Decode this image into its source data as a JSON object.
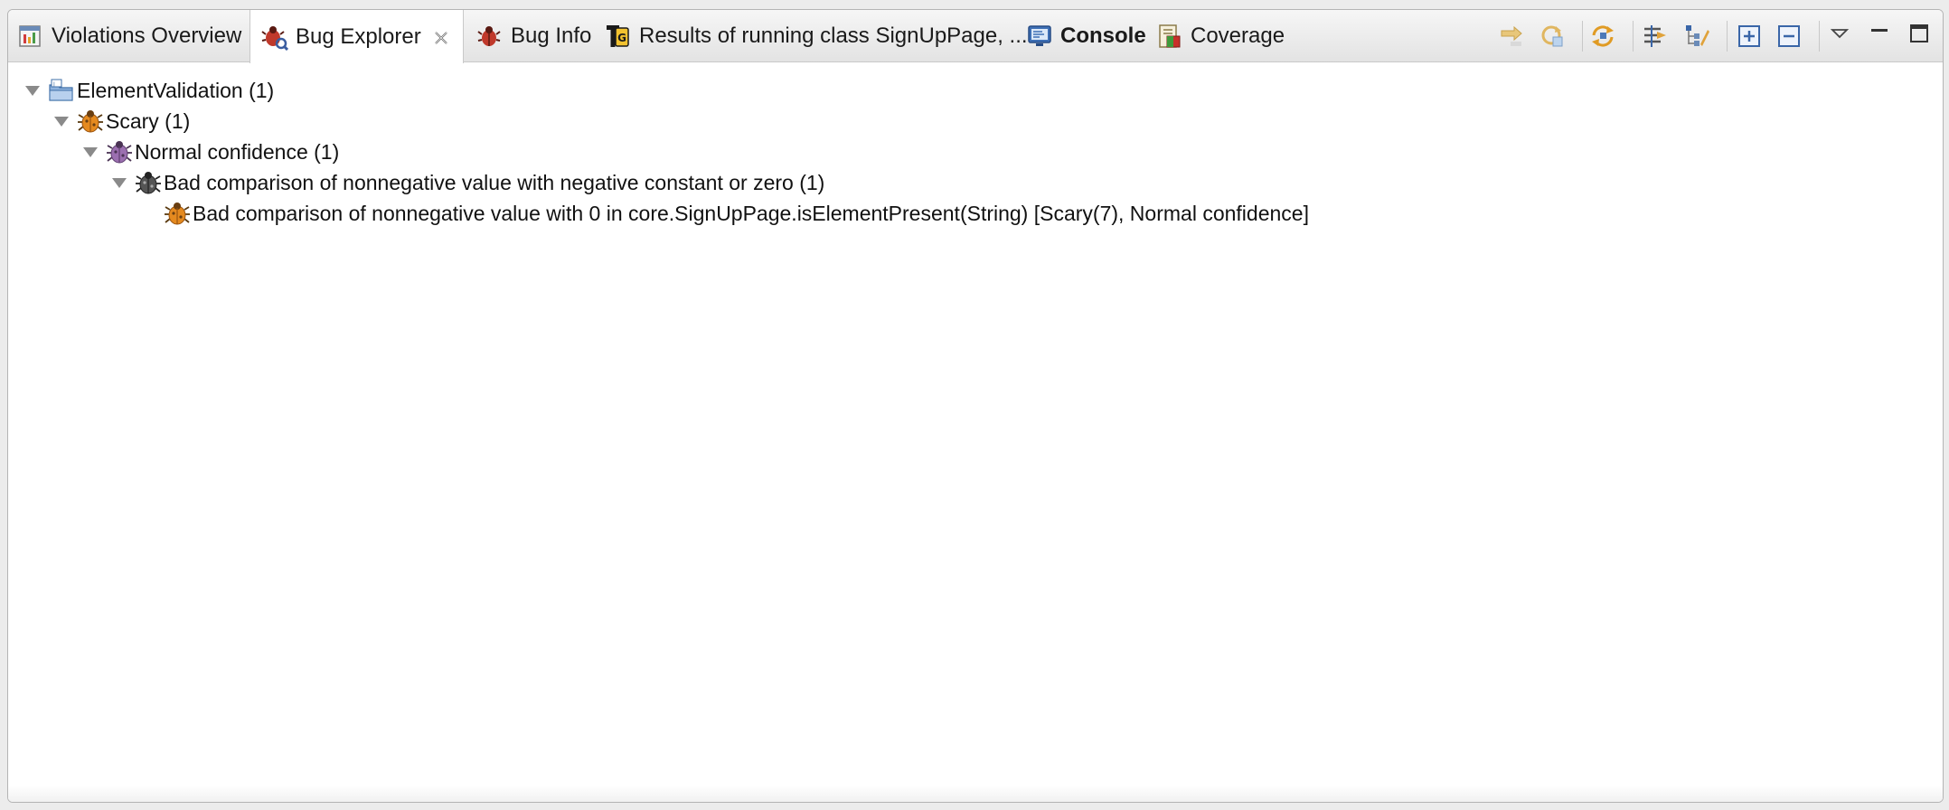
{
  "tabs": [
    {
      "label": "Violations Overview",
      "icon": "violations-overview-icon",
      "active": false,
      "bold": false
    },
    {
      "label": "Bug Explorer",
      "icon": "bug-explorer-icon",
      "active": true,
      "bold": false,
      "closable": true
    },
    {
      "label": "Bug Info",
      "icon": "bug-info-icon",
      "active": false,
      "bold": false
    },
    {
      "label": "Results of running class SignUpPage, ...",
      "icon": "testng-results-icon",
      "active": false,
      "bold": false
    },
    {
      "label": "Console",
      "icon": "console-icon",
      "active": false,
      "bold": true
    },
    {
      "label": "Coverage",
      "icon": "coverage-icon",
      "active": false,
      "bold": false
    }
  ],
  "toolbar": {
    "buttons": [
      "go-to-next-icon",
      "refresh-icon",
      "synchronize-icon",
      "filter-icon",
      "group-by-icon",
      "expand-all-icon",
      "collapse-all-icon",
      "view-menu-icon",
      "minimize-icon",
      "maximize-icon"
    ]
  },
  "tree": [
    {
      "label": "ElementValidation (1)",
      "icon": "project-folder-icon",
      "level": 0,
      "expanded": true
    },
    {
      "label": "Scary (1)",
      "icon": "scary-bug-icon",
      "level": 1,
      "expanded": true
    },
    {
      "label": "Normal confidence (1)",
      "icon": "normal-confidence-bug-icon",
      "level": 2,
      "expanded": true
    },
    {
      "label": "Bad comparison of nonnegative value with negative constant or zero (1)",
      "icon": "bug-pattern-icon",
      "level": 3,
      "expanded": true
    },
    {
      "label": "Bad comparison of nonnegative value with 0 in core.SignUpPage.isElementPresent(String) [Scary(7), Normal confidence]",
      "icon": "bug-instance-icon",
      "level": 4,
      "expanded": null
    }
  ],
  "colors": {
    "bug_orange": "#e58a1f",
    "bug_purple": "#9b6fb0",
    "bug_dark": "#555555",
    "twisty": "#8a8a8a"
  }
}
